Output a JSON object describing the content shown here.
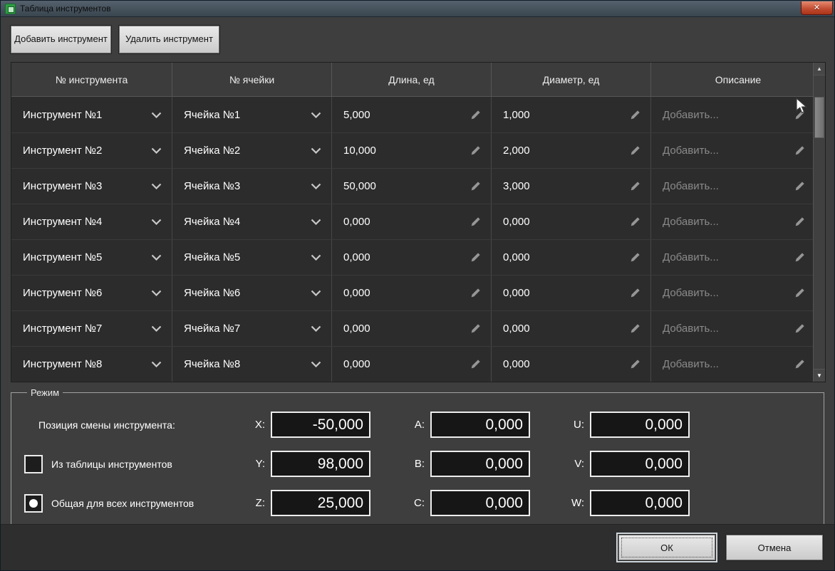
{
  "window": {
    "title": "Таблица инструментов",
    "close_glyph": "✕"
  },
  "toolbar": {
    "add": "Добавить инструмент",
    "remove": "Удалить инструмент"
  },
  "table": {
    "headers": [
      "№ инструмента",
      "№ ячейки",
      "Длина, ед",
      "Диаметр, ед",
      "Описание"
    ],
    "rows": [
      {
        "tool": "Инструмент №1",
        "cell": "Ячейка №1",
        "length": "5,000",
        "diameter": "1,000",
        "description": "Добавить..."
      },
      {
        "tool": "Инструмент №2",
        "cell": "Ячейка №2",
        "length": "10,000",
        "diameter": "2,000",
        "description": "Добавить..."
      },
      {
        "tool": "Инструмент №3",
        "cell": "Ячейка №3",
        "length": "50,000",
        "diameter": "3,000",
        "description": "Добавить..."
      },
      {
        "tool": "Инструмент №4",
        "cell": "Ячейка №4",
        "length": "0,000",
        "diameter": "0,000",
        "description": "Добавить..."
      },
      {
        "tool": "Инструмент №5",
        "cell": "Ячейка №5",
        "length": "0,000",
        "diameter": "0,000",
        "description": "Добавить..."
      },
      {
        "tool": "Инструмент №6",
        "cell": "Ячейка №6",
        "length": "0,000",
        "diameter": "0,000",
        "description": "Добавить..."
      },
      {
        "tool": "Инструмент №7",
        "cell": "Ячейка №7",
        "length": "0,000",
        "diameter": "0,000",
        "description": "Добавить..."
      },
      {
        "tool": "Инструмент №8",
        "cell": "Ячейка №8",
        "length": "0,000",
        "diameter": "0,000",
        "description": "Добавить..."
      }
    ]
  },
  "mode": {
    "legend": "Режим",
    "rows": [
      {
        "left_type": "label",
        "left": "Позиция смены инструмента:",
        "checked": false,
        "fields": [
          {
            "label": "X:",
            "value": "-50,000"
          },
          {
            "label": "A:",
            "value": "0,000"
          },
          {
            "label": "U:",
            "value": "0,000"
          }
        ]
      },
      {
        "left_type": "checkbox",
        "left": "Из таблицы инструментов",
        "checked": false,
        "fields": [
          {
            "label": "Y:",
            "value": "98,000"
          },
          {
            "label": "B:",
            "value": "0,000"
          },
          {
            "label": "V:",
            "value": "0,000"
          }
        ]
      },
      {
        "left_type": "radio",
        "left": "Общая для всех инструментов",
        "checked": true,
        "fields": [
          {
            "label": "Z:",
            "value": "25,000"
          },
          {
            "label": "C:",
            "value": "0,000"
          },
          {
            "label": "W:",
            "value": "0,000"
          }
        ]
      }
    ]
  },
  "footer": {
    "ok": "ОК",
    "cancel": "Отмена"
  },
  "icons": {
    "scroll_up": "▲",
    "scroll_down": "▼"
  },
  "colors": {
    "titlebar": "#47545f",
    "close_red": "#c04a2f",
    "app_icon_green": "#2e9e44",
    "background": "#3e3e3e",
    "row_bg": "#2c2c2c",
    "input_border": "#ededed"
  }
}
